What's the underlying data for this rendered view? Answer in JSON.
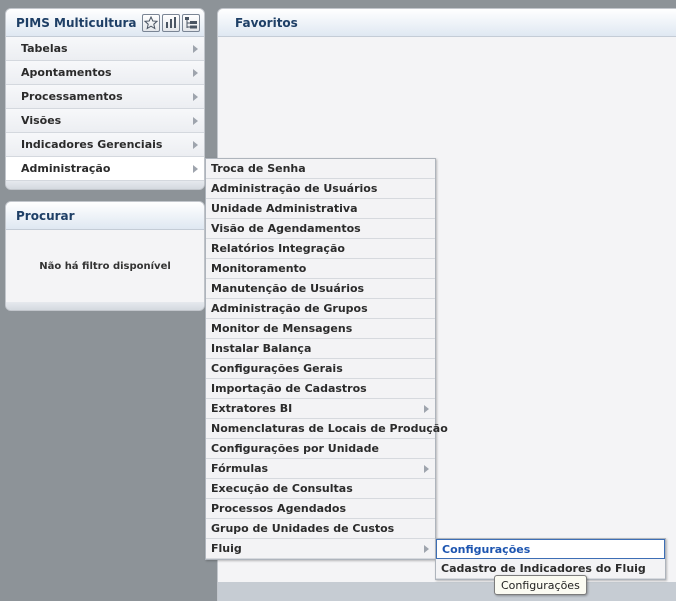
{
  "main_menu": {
    "title": "PIMS Multicultura",
    "header_icons": [
      "star-icon",
      "bar-chart-icon",
      "tree-list-icon"
    ],
    "items": [
      {
        "label": "Tabelas"
      },
      {
        "label": "Apontamentos"
      },
      {
        "label": "Processamentos"
      },
      {
        "label": "Visões"
      },
      {
        "label": "Indicadores Gerenciais"
      },
      {
        "label": "Administração"
      }
    ]
  },
  "search": {
    "title": "Procurar",
    "empty_text": "Não há filtro disponível"
  },
  "favorites": {
    "title": "Favoritos"
  },
  "admin_submenu": {
    "items": [
      {
        "label": "Troca de Senha"
      },
      {
        "label": "Administração de Usuários"
      },
      {
        "label": "Unidade Administrativa"
      },
      {
        "label": "Visão de Agendamentos"
      },
      {
        "label": "Relatórios Integração"
      },
      {
        "label": "Monitoramento"
      },
      {
        "label": "Manutenção de Usuários"
      },
      {
        "label": "Administração de Grupos"
      },
      {
        "label": "Monitor de Mensagens"
      },
      {
        "label": "Instalar Balança"
      },
      {
        "label": "Configurações Gerais"
      },
      {
        "label": "Importação de Cadastros"
      },
      {
        "label": "Extratores BI"
      },
      {
        "label": "Nomenclaturas de Locais de Produção"
      },
      {
        "label": "Configurações por Unidade"
      },
      {
        "label": "Fórmulas"
      },
      {
        "label": "Execução de Consultas"
      },
      {
        "label": "Processos Agendados"
      },
      {
        "label": "Grupo de Unidades de Custos"
      },
      {
        "label": "Fluig"
      }
    ]
  },
  "fluig_submenu": {
    "items": [
      {
        "label": "Configurações"
      },
      {
        "label": "Cadastro de Indicadores do Fluig"
      }
    ]
  },
  "tooltip": {
    "text": "Configurações"
  }
}
